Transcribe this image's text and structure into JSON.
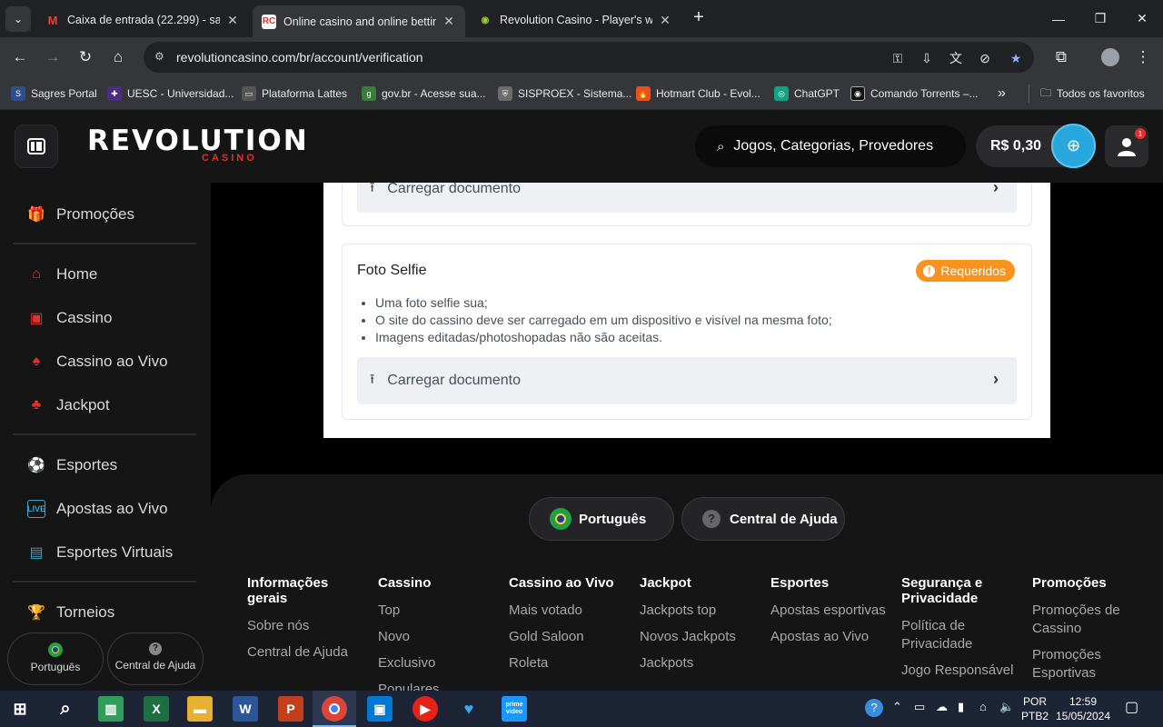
{
  "browser": {
    "tabs": [
      {
        "title": "Caixa de entrada (22.299) - sap",
        "icon": "gmail-icon"
      },
      {
        "title": "Online casino and online bettin",
        "icon": "revolution-casino-icon"
      },
      {
        "title": "Revolution Casino - Player's wit",
        "icon": "revolution-casino-icon"
      }
    ],
    "url": "revolutioncasino.com/br/account/verification",
    "bookmarks": [
      "Sagres Portal",
      "UESC - Universidad...",
      "Plataforma Lattes",
      "gov.br - Acesse sua...",
      "SISPROEX - Sistema...",
      "Hotmart Club - Evol...",
      "ChatGPT",
      "Comando Torrents –..."
    ],
    "bookmarks_overflow": "»",
    "all_bookmarks": "Todos os favoritos"
  },
  "site": {
    "logo": "REVOLUTION",
    "logo_sub": "CASINO",
    "search_placeholder": "Jogos, Categorias, Provedores",
    "balance": "R$ 0,30",
    "notifications": "1"
  },
  "sidebar": {
    "promo": "Promoções",
    "group1": [
      "Home",
      "Cassino",
      "Cassino ao Vivo",
      "Jackpot"
    ],
    "group2": [
      "Esportes",
      "Apostas ao Vivo",
      "Esportes Virtuais"
    ],
    "torneios": "Torneios",
    "language": "Português",
    "help": "Central de Ajuda"
  },
  "verification": {
    "upload_label": "Carregar documento",
    "selfie": {
      "title": "Foto Selfie",
      "badge": "Requeridos",
      "requirements": [
        "Uma foto selfie sua;",
        "O site do cassino deve ser carregado em um dispositivo e visível na mesma foto;",
        "Imagens editadas/photoshopadas não são aceitas."
      ]
    }
  },
  "footer": {
    "language": "Português",
    "help": "Central de Ajuda",
    "columns": [
      {
        "title": "Informações gerais",
        "links": [
          "Sobre nós",
          "Central de Ajuda"
        ]
      },
      {
        "title": "Cassino",
        "links": [
          "Top",
          "Novo",
          "Exclusivo",
          "Populares"
        ]
      },
      {
        "title": "Cassino ao Vivo",
        "links": [
          "Mais votado",
          "Gold Saloon",
          "Roleta"
        ]
      },
      {
        "title": "Jackpot",
        "links": [
          "Jackpots top",
          "Novos Jackpots",
          "Jackpots"
        ]
      },
      {
        "title": "Esportes",
        "links": [
          "Apostas esportivas",
          "Apostas ao Vivo"
        ]
      },
      {
        "title": "Segurança e Privacidade",
        "links": [
          "Política de Privacidade",
          "Jogo Responsável"
        ]
      },
      {
        "title": "Promoções",
        "links": [
          "Promoções de Cassino",
          "Promoções Esportivas"
        ]
      }
    ]
  },
  "taskbar": {
    "lang": "POR",
    "layout": "PTB2",
    "time": "12:59",
    "date": "15/05/2024"
  }
}
